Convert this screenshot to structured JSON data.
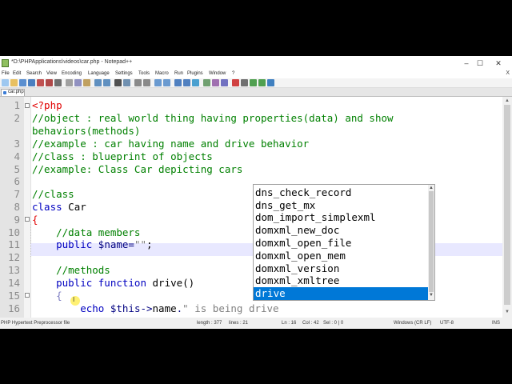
{
  "window": {
    "title": "*D:\\PHPApplications\\videos\\car.php - Notepad++",
    "minimize": "–",
    "maximize": "☐",
    "close": "✕"
  },
  "menu": {
    "items": [
      "File",
      "Edit",
      "Search",
      "View",
      "Encoding",
      "Language",
      "Settings",
      "Tools",
      "Macro",
      "Run",
      "Plugins",
      "Window",
      "?"
    ],
    "close": "X"
  },
  "tab": {
    "label": "car.php"
  },
  "editor": {
    "lines": [
      "1",
      "2",
      "",
      "3",
      "4",
      "5",
      "6",
      "7",
      "8",
      "9",
      "10",
      "11",
      "12",
      "13",
      "14",
      "15",
      "16"
    ],
    "code": {
      "l1_tag": "<?php",
      "l2": "//object : real world thing having properties(data) and show",
      "l2b": "behaviors(methods)",
      "l3": "//example : car having name and drive behavior",
      "l4": "//class : blueprint of objects",
      "l5": "//example: Class Car depicting cars",
      "l7": "//class",
      "l8_kw": "class",
      "l8_name": " Car",
      "l9": "{",
      "l10": "    //data members",
      "l11_kw": "    public",
      "l11_var": " $name",
      "l11_eq": "=",
      "l11_str": "\"\"",
      "l11_end": ";",
      "l13": "    //methods",
      "l14_kw": "    public function",
      "l14_fn": " drive()",
      "l15": "    {",
      "l16_kw": "        echo",
      "l16_var": " $this",
      "l16_op": "->",
      "l16_name": "name",
      "l16_dot": ".",
      "l16_str": "\" is being drive"
    }
  },
  "autocomplete": {
    "items": [
      "dns_check_record",
      "dns_get_mx",
      "dom_import_simplexml",
      "domxml_new_doc",
      "domxml_open_file",
      "domxml_open_mem",
      "domxml_version",
      "domxml_xmltree",
      "drive"
    ],
    "selected": "drive"
  },
  "status": {
    "filetype": "PHP Hypertext Preprocessor file",
    "length": "length : 377",
    "lines": "lines : 21",
    "ln": "Ln : 16",
    "col": "Col : 42",
    "sel": "Sel : 0 | 0",
    "eol": "Windows (CR LF)",
    "encoding": "UTF-8",
    "mode": "INS"
  },
  "colors": {
    "comment": "#008000",
    "keyword": "#0000c0",
    "php_tag": "#e00000",
    "string": "#808080",
    "selection": "#0078d7",
    "current_line": "#e8e8ff"
  }
}
